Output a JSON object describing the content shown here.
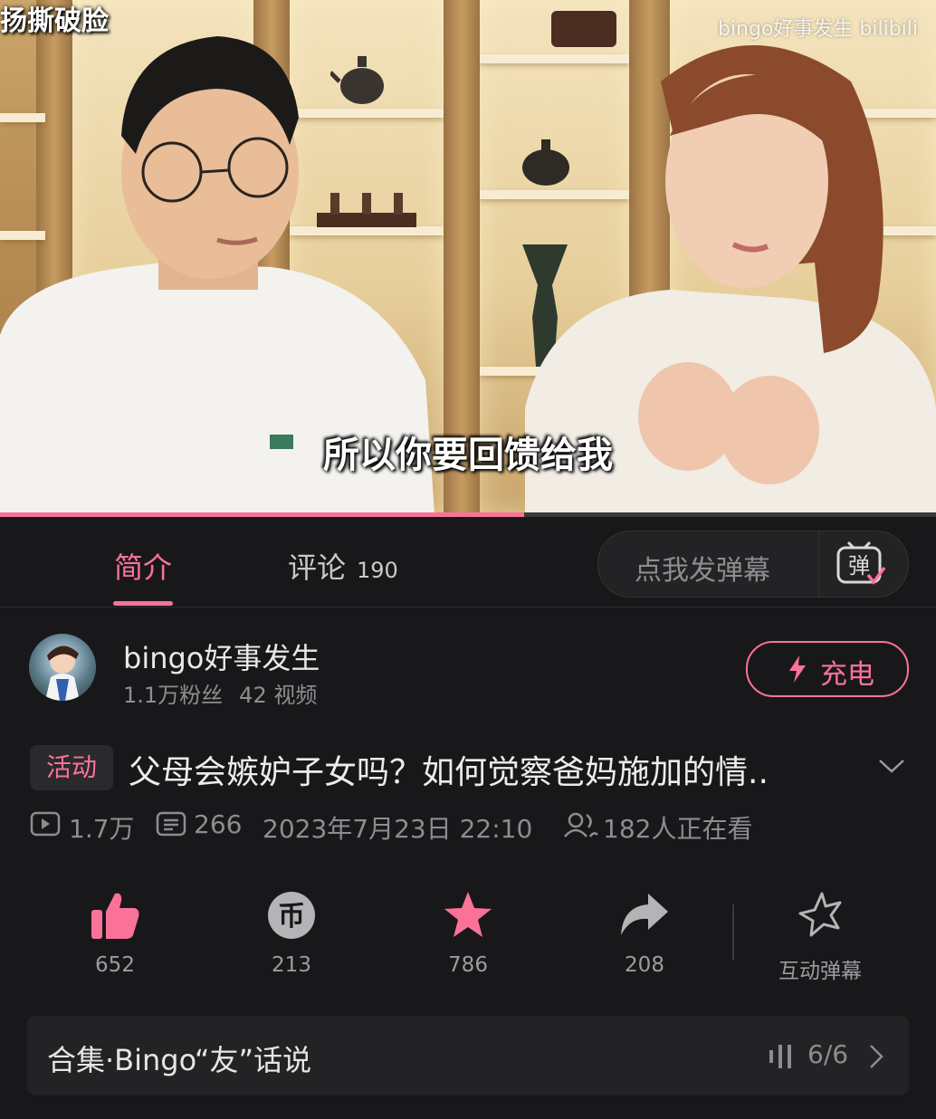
{
  "video": {
    "subtitle": "所以你要回馈给我",
    "corner_title": "扬撕破脸",
    "watermark": "bingo好事发生 bilibili",
    "progress_fraction": 0.56
  },
  "tabs": {
    "intro_label": "简介",
    "comments_label": "评论",
    "comments_count": "190",
    "danmu_placeholder": "点我发弹幕",
    "danmu_icon_text": "弹"
  },
  "uploader": {
    "name": "bingo好事发生",
    "fans": "1.1万粉丝",
    "videos": "42 视频",
    "charge_label": "充电"
  },
  "title": {
    "tag": "活动",
    "text": "父母会嫉妒子女吗？如何觉察爸妈施加的情.."
  },
  "meta": {
    "views": "1.7万",
    "danmaku": "266",
    "date": "2023年7月23日 22:10",
    "watching": "182人正在看"
  },
  "actions": {
    "like": "652",
    "coin": "213",
    "favorite": "786",
    "share": "208",
    "interactive_danmu": "互动弹幕"
  },
  "collection": {
    "name": "合集·Bingo“友”话说",
    "progress": "6/6"
  },
  "colors": {
    "accent": "#fb7299",
    "background": "#18181a"
  }
}
